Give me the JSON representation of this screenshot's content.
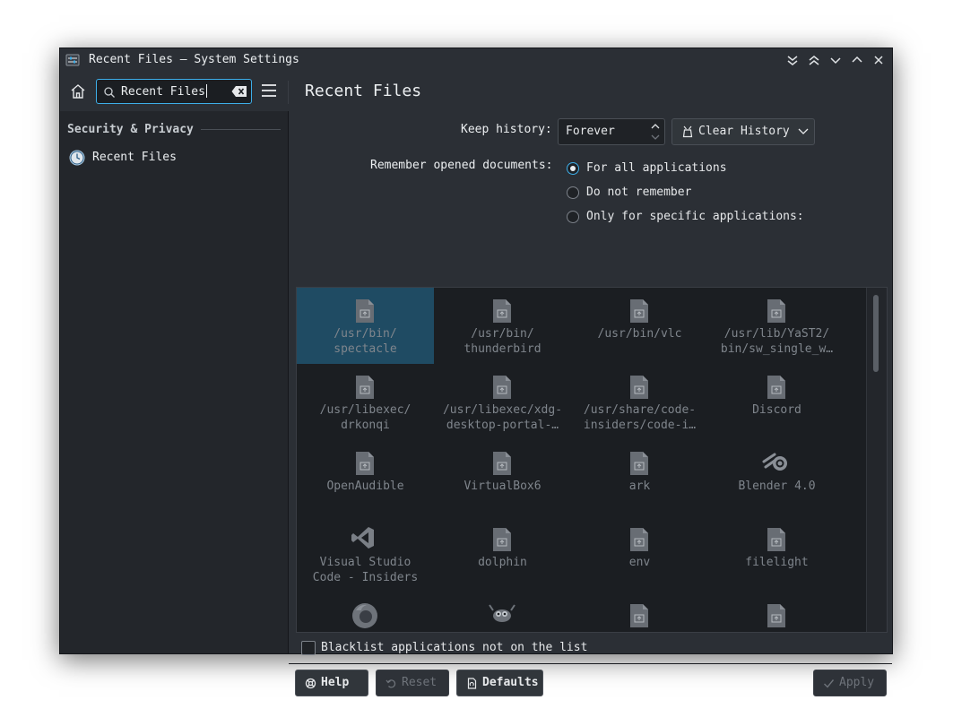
{
  "window": {
    "title": "Recent Files — System Settings"
  },
  "toolbar": {
    "search_value": "Recent Files",
    "page_title": "Recent Files"
  },
  "sidebar": {
    "section": "Security & Privacy",
    "items": [
      {
        "label": "Recent Files"
      }
    ]
  },
  "settings": {
    "keep_history_label": "Keep history:",
    "keep_history_value": "Forever",
    "clear_history_label": "Clear History",
    "remember_label": "Remember opened documents:",
    "radios": [
      {
        "label": "For all applications",
        "checked": true
      },
      {
        "label": "Do not remember",
        "checked": false
      },
      {
        "label": "Only for specific applications:",
        "checked": false
      }
    ],
    "blacklist_label": "Blacklist applications not on the list"
  },
  "apps": [
    {
      "label": "/usr/bin/\nspectacle",
      "icon": "generic-file-icon",
      "selected": true
    },
    {
      "label": "/usr/bin/\nthunderbird",
      "icon": "generic-file-icon"
    },
    {
      "label": "/usr/bin/vlc",
      "icon": "generic-file-icon"
    },
    {
      "label": "/usr/lib/YaST2/\nbin/sw_single_w…",
      "icon": "generic-file-icon"
    },
    {
      "label": "/usr/libexec/\ndrkonqi",
      "icon": "generic-file-icon"
    },
    {
      "label": "/usr/libexec/xdg-\ndesktop-portal-…",
      "icon": "generic-file-icon"
    },
    {
      "label": "/usr/share/code-\ninsiders/code-i…",
      "icon": "generic-file-icon"
    },
    {
      "label": "Discord",
      "icon": "generic-file-icon"
    },
    {
      "label": "OpenAudible",
      "icon": "generic-file-icon"
    },
    {
      "label": "VirtualBox6",
      "icon": "generic-file-icon"
    },
    {
      "label": "ark",
      "icon": "generic-file-icon"
    },
    {
      "label": "Blender 4.0",
      "icon": "blender-icon"
    },
    {
      "label": "Visual Studio\nCode - Insiders",
      "icon": "vscode-icon"
    },
    {
      "label": "dolphin",
      "icon": "generic-file-icon"
    },
    {
      "label": "env",
      "icon": "generic-file-icon"
    },
    {
      "label": "filelight",
      "icon": "generic-file-icon"
    },
    {
      "label": "",
      "icon": "firefox-icon"
    },
    {
      "label": "",
      "icon": "gimp-icon"
    },
    {
      "label": "",
      "icon": "generic-file-icon"
    },
    {
      "label": "",
      "icon": "generic-file-icon"
    }
  ],
  "footer": {
    "help": "Help",
    "reset": "Reset",
    "defaults": "Defaults",
    "apply": "Apply"
  },
  "colors": {
    "accent": "#3daee9",
    "selection": "#1f4b63"
  }
}
